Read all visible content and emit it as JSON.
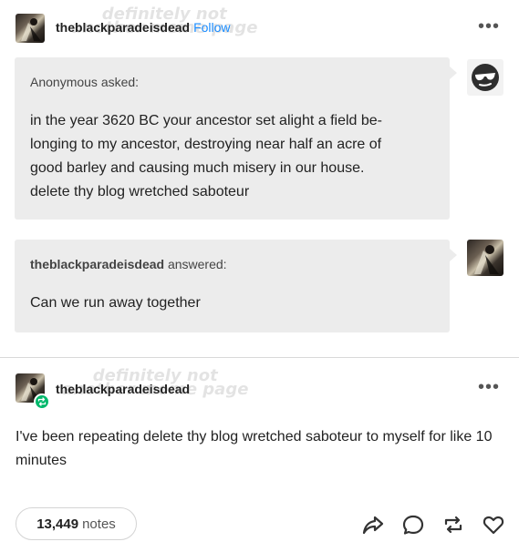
{
  "post1": {
    "username": "theblackparadeisdead",
    "follow_label": "Follow",
    "watermark_line1": "definitely not",
    "watermark_line2": "another meme page",
    "more_label": "•••",
    "ask": {
      "asker_name": "Anonymous",
      "asker_suffix": "asked:",
      "question": "in the year 3620 BC your ancestor set alight a field be-\nlonging to my ancestor, destroying near half an acre of\ngood barley and causing much misery in our house.\ndelete thy blog wretched saboteur"
    },
    "answer": {
      "answerer_name": "theblackparadeisdead",
      "answerer_suffix": "answered:",
      "text": "Can we run away together"
    }
  },
  "post2": {
    "username": "theblackparadeisdead",
    "watermark_line1": "definitely not",
    "watermark_line2": "another meme page",
    "more_label": "•••",
    "body": "I've been repeating delete thy blog wretched saboteur to myself for like 10 minutes",
    "notes_count": "13,449",
    "notes_label": "notes"
  },
  "icons": {
    "anon_avatar": "sunglasses-face-icon",
    "share": "share-arrow-icon",
    "reply": "speech-bubble-icon",
    "reblog": "reblog-icon",
    "like": "heart-icon"
  },
  "colors": {
    "follow": "#1a8cff",
    "bubble": "#ececec",
    "reblog_badge": "#00b86b"
  }
}
